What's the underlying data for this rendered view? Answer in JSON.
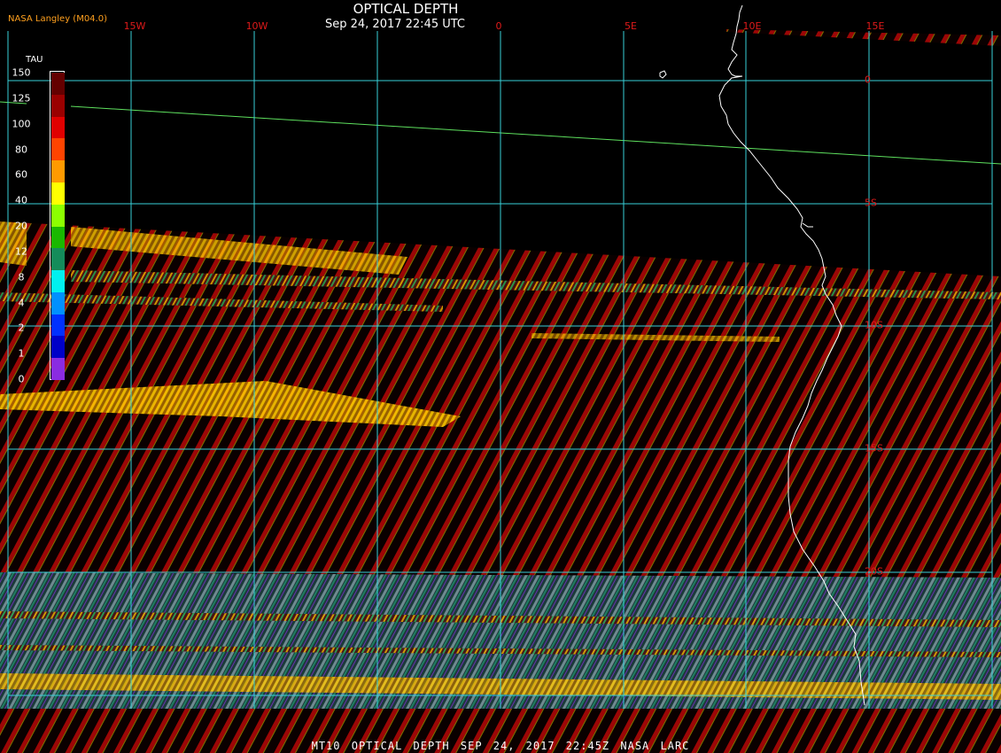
{
  "header": {
    "title": "OPTICAL DEPTH",
    "subtitle": "Sep 24, 2017 22:45 UTC",
    "credit": "NASA Langley (M04.0)"
  },
  "footer": {
    "caption": "MT10  OPTICAL DEPTH  SEP 24, 2017 22:45Z  NASA LARC"
  },
  "map": {
    "longitude_labels": [
      "15W",
      "10W",
      "0",
      "5E",
      "10E",
      "15E"
    ],
    "latitude_labels": [
      "0",
      "5S",
      "10S",
      "15S",
      "20S"
    ],
    "colors": {
      "background": "#000000",
      "graticule": "#38d0d8",
      "coastline": "#ffffff",
      "terminator": "#5ee05e",
      "labels": "#e01a1a",
      "dark_stripe": "#0a0000"
    }
  },
  "legend": {
    "title": "TAU",
    "ticks": [
      "150",
      "125",
      "100",
      "80",
      "60",
      "40",
      "20",
      "12",
      "8",
      "4",
      "2",
      "1",
      "0"
    ],
    "colors": [
      "#640000",
      "#9a0000",
      "#e00000",
      "#ff4400",
      "#ff9a00",
      "#ffff00",
      "#8cff00",
      "#1ab800",
      "#148c5a",
      "#00f0f0",
      "#0090ff",
      "#0030ff",
      "#0000c8",
      "#8a2be2"
    ]
  }
}
